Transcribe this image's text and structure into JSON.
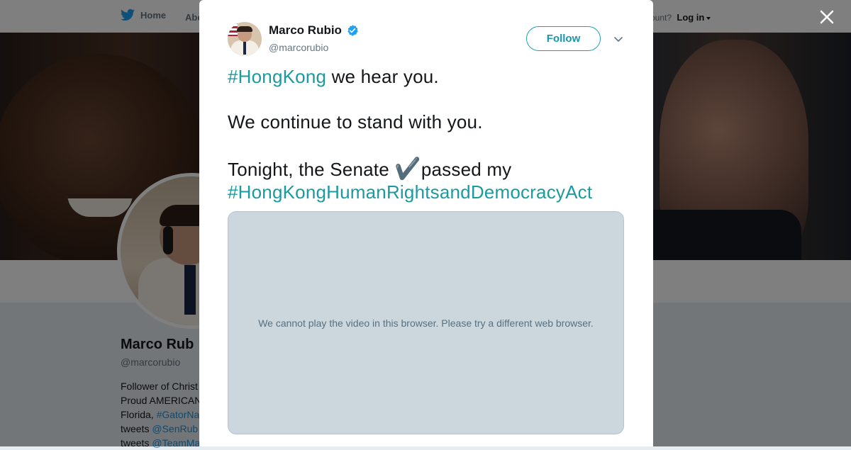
{
  "nav": {
    "home_label": "Home",
    "about_label": "Abo",
    "account_prompt": "ccount?",
    "login_label": "Log in"
  },
  "profile": {
    "name": "Marco Rub",
    "handle": "@marcorubio",
    "bio_lines": [
      {
        "text": "Follower of Christ"
      },
      {
        "text": "Proud AMERICAN"
      },
      {
        "text": "Florida, ",
        "link": "#GatorNa"
      },
      {
        "text": "tweets ",
        "link": "@SenRub"
      },
      {
        "text": "tweets ",
        "link": "@TeamMa"
      }
    ]
  },
  "tweet": {
    "author_name": "Marco Rubio",
    "author_handle": "@marcorubio",
    "follow_label": "Follow",
    "line1_hashtag": "#HongKong",
    "line1_rest": " we hear you.",
    "line2": "We continue to stand with you.",
    "line3_start": "Tonight, the Senate ",
    "line3_check": "✔️",
    "line3_end": "passed my",
    "line4_hashtag": "#HongKongHumanRightsandDemocracyAct",
    "video_message": "We cannot play the video in this browser. Please try a different web browser."
  },
  "colors": {
    "link": "#1b9aa0",
    "verified": "#1da1f2",
    "video_bg": "#ccd6dd"
  },
  "icons": {
    "nav_home": "twitter-bird-icon",
    "close": "close-icon",
    "verified": "verified-badge-icon",
    "menu": "chevron-down-icon"
  }
}
